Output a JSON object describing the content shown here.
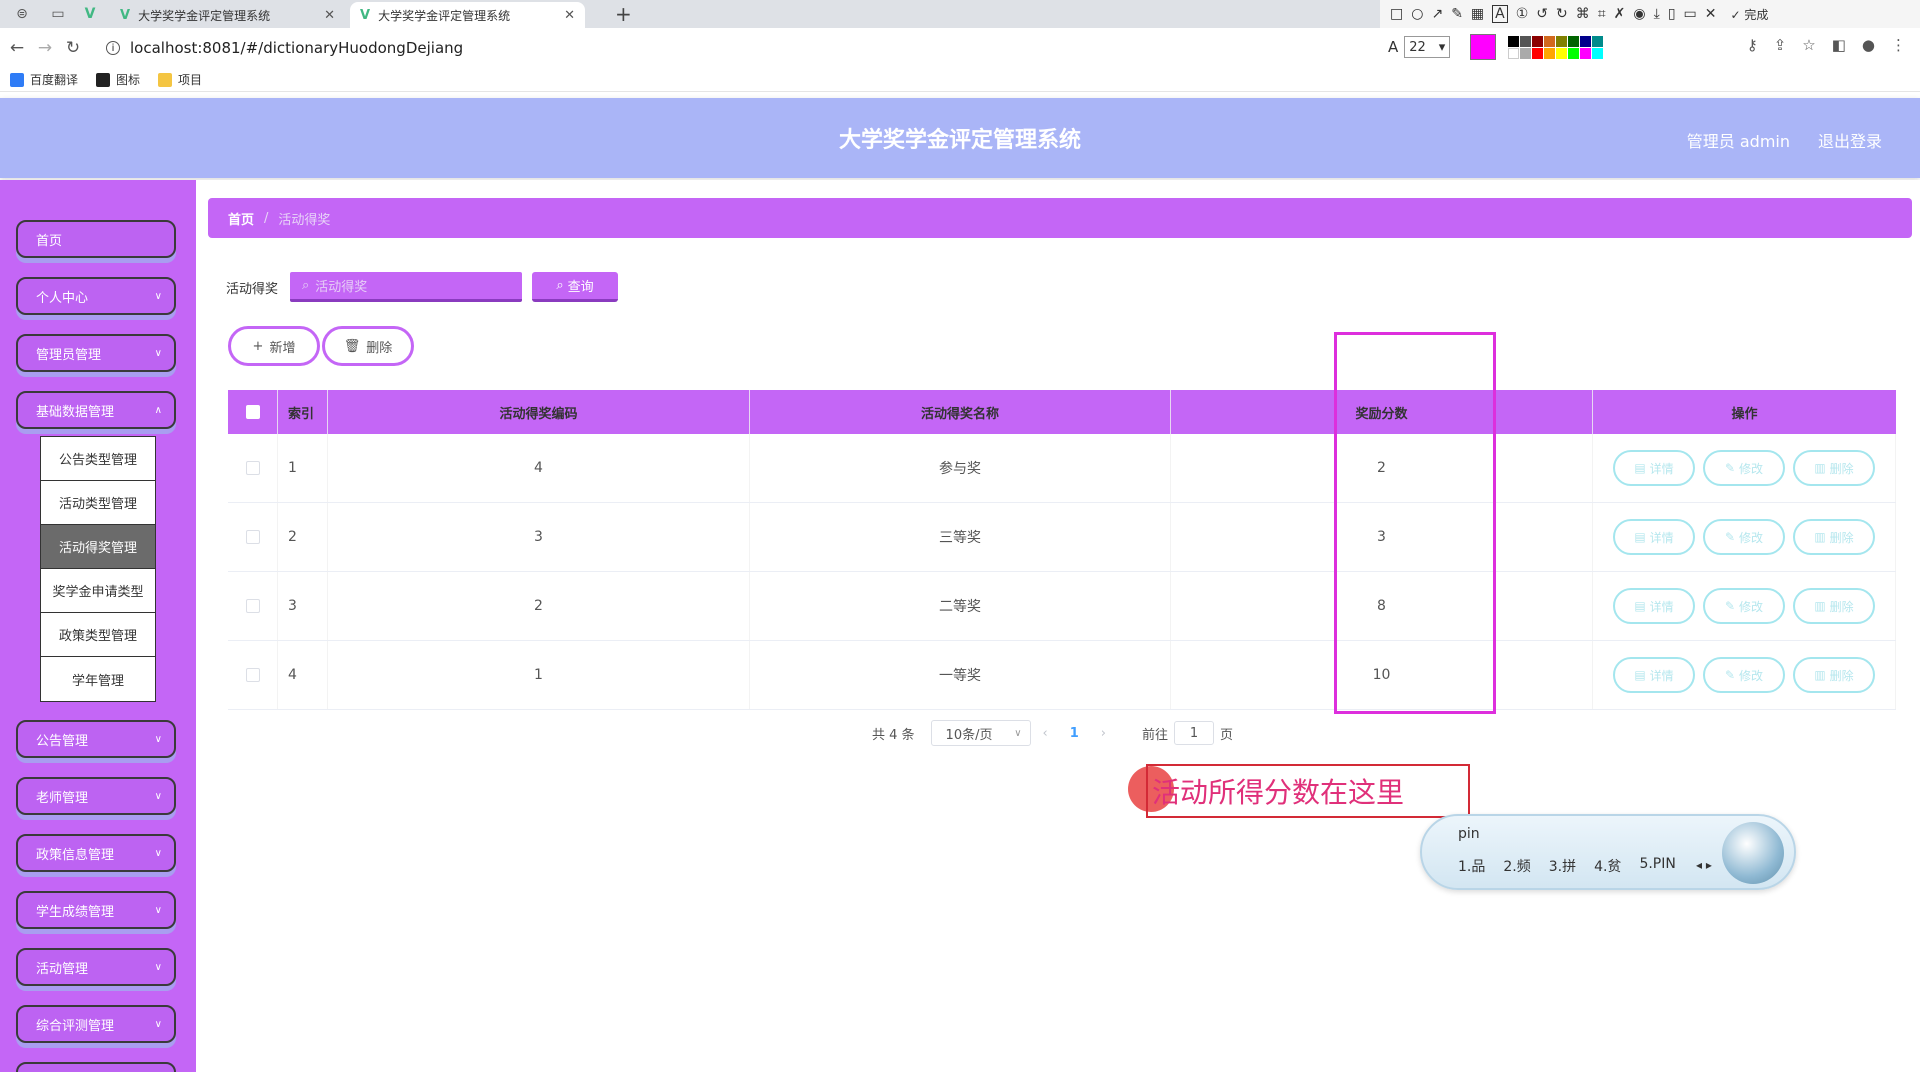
{
  "browser": {
    "tabs": [
      {
        "title": "大学奖学金评定管理系统"
      },
      {
        "title": "大学奖学金评定管理系统"
      }
    ],
    "url": "localhost:8081/#/dictionaryHuodongDejiang",
    "font_size": "22",
    "done_label": "完成",
    "bookmarks": [
      "百度翻译",
      "图标",
      "项目"
    ]
  },
  "header": {
    "title": "大学奖学金评定管理系统",
    "user": "管理员 admin",
    "logout": "退出登录"
  },
  "sidebar": {
    "items": [
      {
        "label": "首页"
      },
      {
        "label": "个人中心"
      },
      {
        "label": "管理员管理"
      },
      {
        "label": "基础数据管理"
      },
      {
        "label": "公告管理"
      },
      {
        "label": "老师管理"
      },
      {
        "label": "政策信息管理"
      },
      {
        "label": "学生成绩管理"
      },
      {
        "label": "活动管理"
      },
      {
        "label": "综合评测管理"
      }
    ],
    "submenu": [
      {
        "label": "公告类型管理"
      },
      {
        "label": "活动类型管理"
      },
      {
        "label": "活动得奖管理",
        "active": true
      },
      {
        "label": "奖学金申请类型"
      },
      {
        "label": "政策类型管理"
      },
      {
        "label": "学年管理"
      }
    ]
  },
  "breadcrumb": {
    "home": "首页",
    "sep": "/",
    "current": "活动得奖"
  },
  "search": {
    "label": "活动得奖",
    "placeholder": "活动得奖",
    "button": "查询"
  },
  "actions": {
    "add": "新增",
    "delete": "删除"
  },
  "table": {
    "headers": [
      "索引",
      "活动得奖编码",
      "活动得奖名称",
      "奖励分数",
      "操作"
    ],
    "rows": [
      {
        "index": "1",
        "code": "4",
        "name": "参与奖",
        "score": "2"
      },
      {
        "index": "2",
        "code": "3",
        "name": "三等奖",
        "score": "3"
      },
      {
        "index": "3",
        "code": "2",
        "name": "二等奖",
        "score": "8"
      },
      {
        "index": "4",
        "code": "1",
        "name": "一等奖",
        "score": "10"
      }
    ],
    "ops": {
      "detail": "详情",
      "edit": "修改",
      "delete": "删除"
    }
  },
  "pagination": {
    "total": "共 4 条",
    "page_size": "10条/页",
    "current": "1",
    "goto_label": "前往",
    "goto_value": "1",
    "page_suffix": "页"
  },
  "annotation": {
    "text": "活动所得分数在这里"
  },
  "ime": {
    "typed": "pin",
    "candidates": [
      "1.品",
      "2.频",
      "3.拼",
      "4.贫",
      "5.PIN"
    ]
  },
  "colors": {
    "header": "#aab5f7",
    "sidebar": "#c466f6",
    "accent": "#c466f6",
    "op_border": "#a4e6ee",
    "highlight": "#dd2fdd"
  }
}
